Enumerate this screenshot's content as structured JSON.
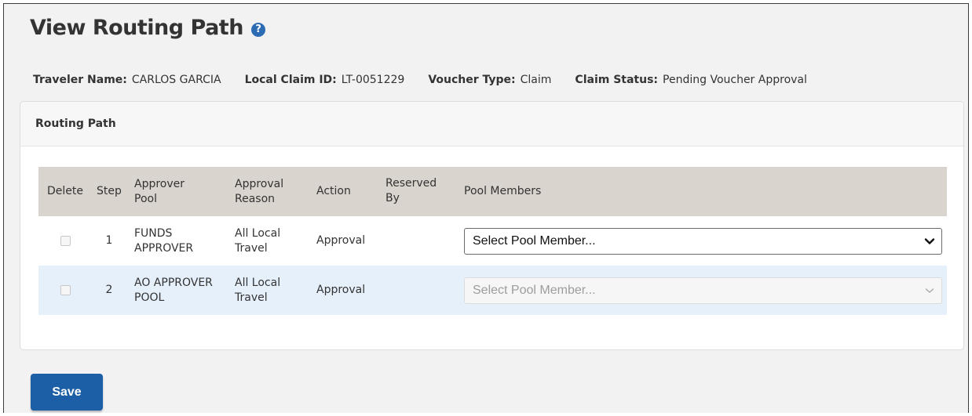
{
  "page": {
    "title": "View Routing Path",
    "help_icon": "?"
  },
  "info": {
    "traveler_label": "Traveler Name:",
    "traveler_value": "CARLOS GARCIA",
    "claim_id_label": "Local Claim ID:",
    "claim_id_value": "LT-0051229",
    "voucher_type_label": "Voucher Type:",
    "voucher_type_value": "Claim",
    "claim_status_label": "Claim Status:",
    "claim_status_value": "Pending Voucher Approval"
  },
  "panel": {
    "title": "Routing Path"
  },
  "table": {
    "headers": {
      "delete": "Delete",
      "step": "Step",
      "approver_pool_1": "Approver",
      "approver_pool_2": "Pool",
      "approval_reason_1": "Approval",
      "approval_reason_2": "Reason",
      "action": "Action",
      "reserved_by_1": "Reserved",
      "reserved_by_2": "By",
      "pool_members": "Pool Members"
    },
    "rows": [
      {
        "step": "1",
        "pool_1": "FUNDS",
        "pool_2": "APPROVER",
        "reason_1": "All Local",
        "reason_2": "Travel",
        "action": "Approval",
        "reserved_by": "",
        "member_placeholder": "Select Pool Member...",
        "member_enabled": true
      },
      {
        "step": "2",
        "pool_1": "AO APPROVER",
        "pool_2": "POOL",
        "reason_1": "All Local",
        "reason_2": "Travel",
        "action": "Approval",
        "reserved_by": "",
        "member_placeholder": "Select Pool Member...",
        "member_enabled": false
      }
    ]
  },
  "buttons": {
    "save": "Save"
  },
  "colors": {
    "page_bg": "#f2f2f2",
    "header_row": "#d9d4ce",
    "alt_row": "#e6f0fb",
    "primary": "#1d5fa6",
    "help_icon": "#2b6cb3"
  },
  "icons": {
    "help": "help-icon",
    "dropdown": "chevron-down-icon",
    "checkbox": "checkbox"
  }
}
